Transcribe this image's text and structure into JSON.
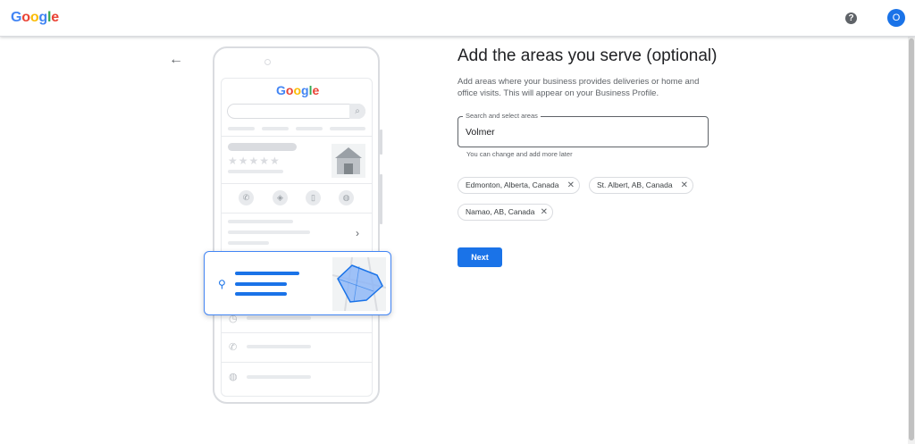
{
  "header": {
    "logo_letters": [
      {
        "char": "G",
        "color": "#4285F4"
      },
      {
        "char": "o",
        "color": "#EA4335"
      },
      {
        "char": "o",
        "color": "#FBBC05"
      },
      {
        "char": "g",
        "color": "#4285F4"
      },
      {
        "char": "l",
        "color": "#34A853"
      },
      {
        "char": "e",
        "color": "#EA4335"
      }
    ],
    "help_glyph": "?",
    "avatar_initial": "O"
  },
  "back_arrow": "←",
  "main": {
    "title": "Add the areas you serve (optional)",
    "description": "Add areas where your business provides deliveries or home and office visits. This will appear on your Business Profile.",
    "search_field": {
      "label": "Search and select areas",
      "value": "Volmer"
    },
    "helper_text": "You can change and add more later",
    "chips": [
      {
        "label": "Edmonton, Alberta, Canada"
      },
      {
        "label": "St. Albert, AB, Canada"
      },
      {
        "label": "Namao, AB, Canada"
      }
    ],
    "chip_remove_glyph": "✕",
    "next_label": "Next"
  },
  "colors": {
    "accent": "#1a73e8",
    "text": "#202124",
    "secondary_text": "#5f6368"
  }
}
